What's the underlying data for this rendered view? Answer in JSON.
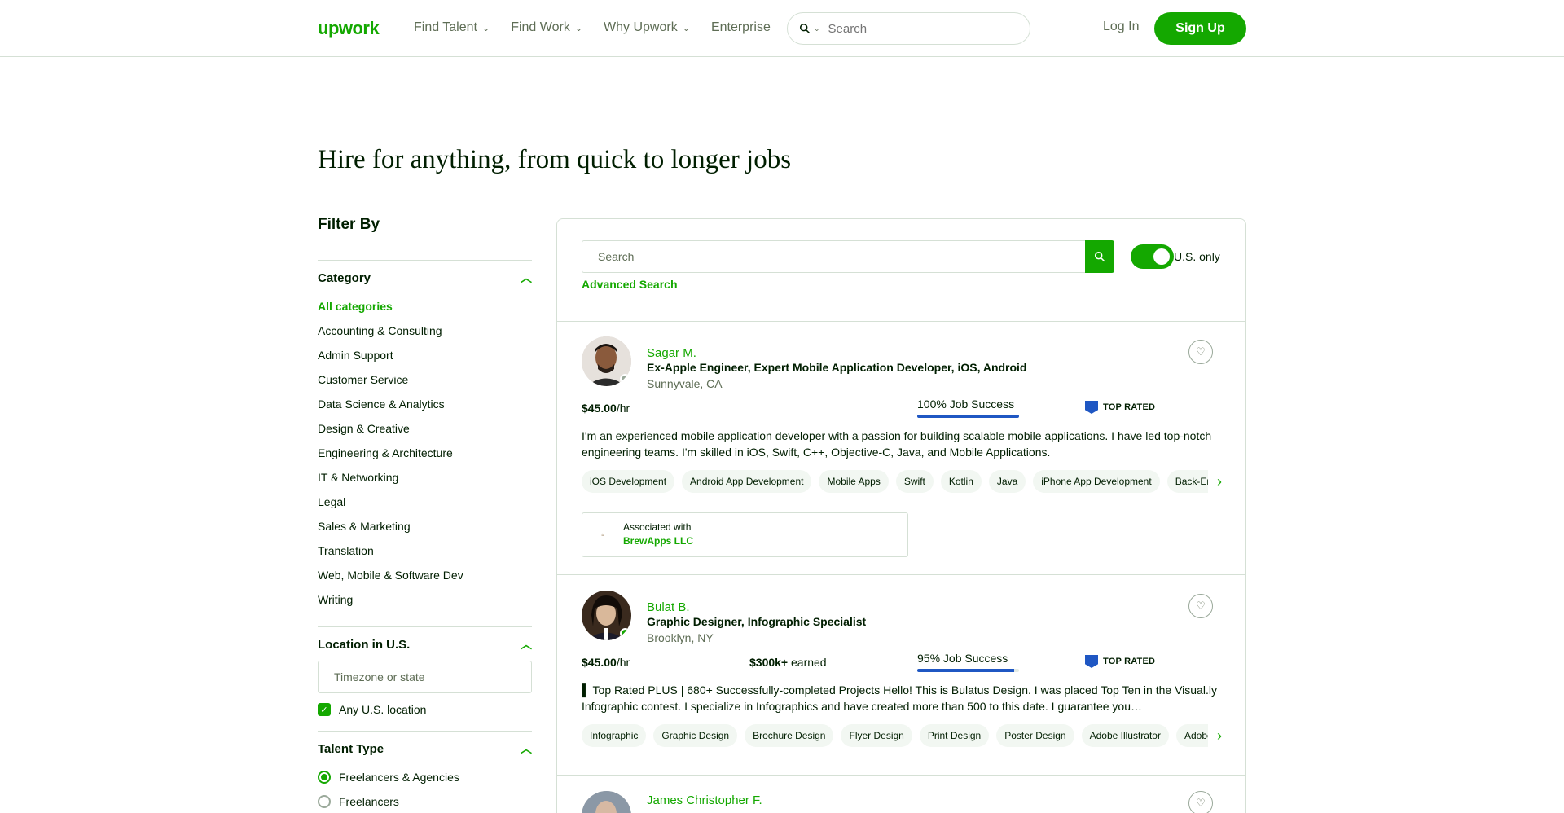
{
  "header": {
    "logo": "upwork",
    "nav": [
      "Find Talent",
      "Find Work",
      "Why Upwork",
      "Enterprise"
    ],
    "search_placeholder": "Search",
    "login": "Log In",
    "signup": "Sign Up"
  },
  "headline": "Hire for anything, from quick to longer jobs",
  "sidebar": {
    "title": "Filter By",
    "category_label": "Category",
    "categories": [
      "All categories",
      "Accounting & Consulting",
      "Admin Support",
      "Customer Service",
      "Data Science & Analytics",
      "Design & Creative",
      "Engineering & Architecture",
      "IT & Networking",
      "Legal",
      "Sales & Marketing",
      "Translation",
      "Web, Mobile & Software Dev",
      "Writing"
    ],
    "location_label": "Location in U.S.",
    "location_placeholder": "Timezone or state",
    "any_location": "Any U.S. location",
    "talent_type_label": "Talent Type",
    "talent_types": [
      "Freelancers & Agencies",
      "Freelancers"
    ]
  },
  "main": {
    "search_placeholder": "Search",
    "us_only": "U.S. only",
    "advanced_search": "Advanced Search"
  },
  "freelancers": [
    {
      "name": "Sagar M.",
      "title": "Ex-Apple Engineer, Expert Mobile Application Developer, iOS, Android",
      "location": "Sunnyvale, CA",
      "rate": "$45.00",
      "rate_unit": "/hr",
      "earned": "",
      "earned_label": "",
      "job_success": "100% Job Success",
      "job_success_value": 100,
      "badge": "TOP RATED",
      "description": "I'm an experienced mobile application developer with a passion for building scalable mobile applications. I have led top-notch engineering teams. I'm skilled in iOS, Swift, C++, Objective-C, Java, and Mobile Applications.",
      "skills": [
        "iOS Development",
        "Android App Development",
        "Mobile Apps",
        "Swift",
        "Kotlin",
        "Java",
        "iPhone App Development",
        "Back-End Development"
      ],
      "associated_label": "Associated with",
      "associated_name": "BrewApps LLC",
      "online": false
    },
    {
      "name": "Bulat B.",
      "title": "Graphic Designer, Infographic Specialist",
      "location": "Brooklyn, NY",
      "rate": "$45.00",
      "rate_unit": "/hr",
      "earned": "$300k+",
      "earned_label": " earned",
      "job_success": "95% Job Success",
      "job_success_value": 95,
      "badge": "TOP RATED",
      "description_plus": "PLUS",
      "description": "▌ Top Rated PLUS | 680+ Successfully-completed Projects Hello! This is Bulatus Design. I was placed Top Ten in the Visual.ly Infographic contest. I specialize in Infographics and have created more than 500 to this date. I guarantee you…",
      "skills": [
        "Infographic",
        "Graphic Design",
        "Brochure Design",
        "Flyer Design",
        "Print Design",
        "Poster Design",
        "Adobe Illustrator",
        "Adobe Photoshop"
      ],
      "online": true
    },
    {
      "name": "James Christopher F."
    }
  ],
  "colors": {
    "brand": "#14a800",
    "text": "#001e00",
    "muted": "#5e6d55",
    "badge_blue": "#1f57c3"
  }
}
